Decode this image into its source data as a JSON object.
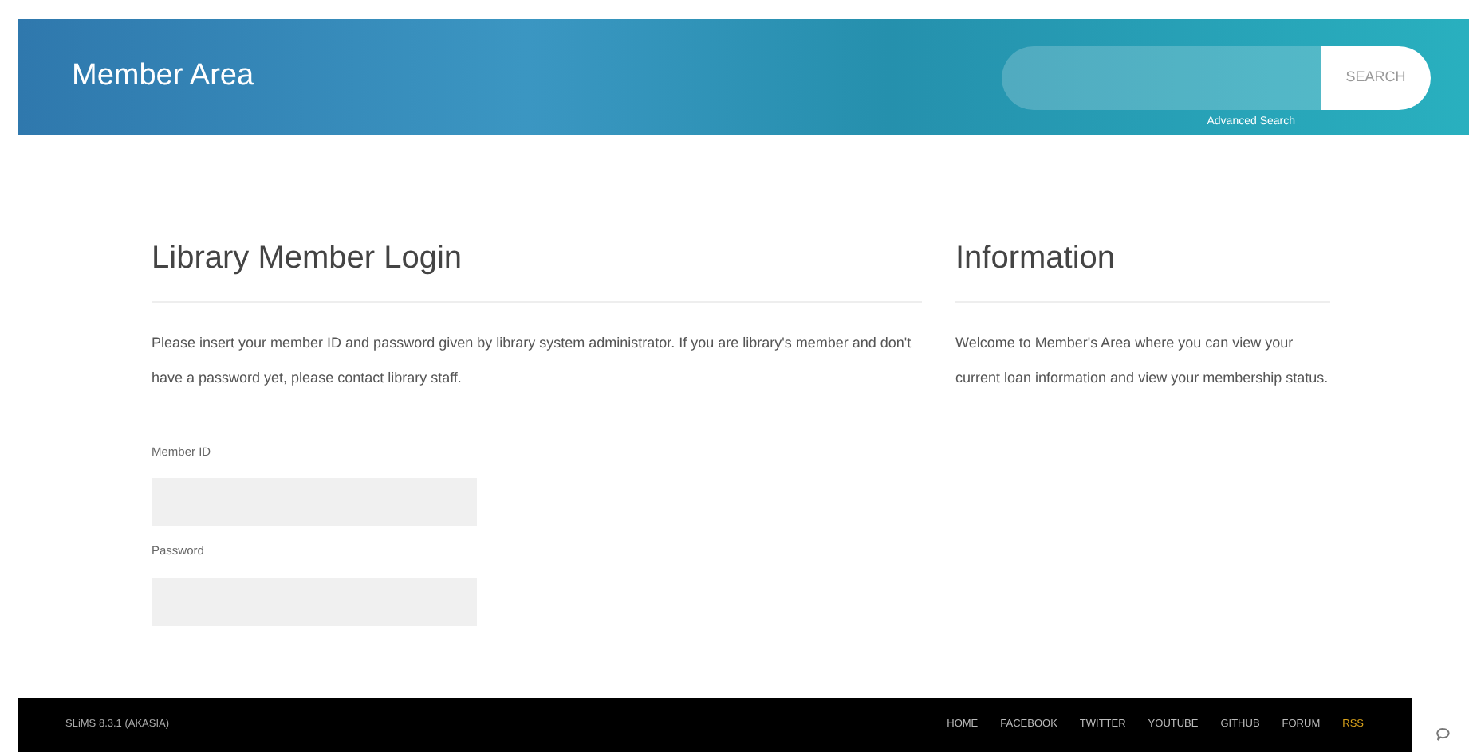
{
  "header": {
    "title": "Member Area",
    "search": {
      "button": "SEARCH"
    },
    "advanced_search": "Advanced Search"
  },
  "login": {
    "title": "Library Member Login",
    "intro": "Please insert your member ID and password given by library system administrator. If you are library's member and don't have a password yet, please contact library staff.",
    "fields": [
      {
        "label": "Member ID"
      },
      {
        "label": "Password"
      }
    ]
  },
  "info": {
    "title": "Information",
    "text": "Welcome to Member's Area where you can view your current loan information and view your membership status."
  },
  "footer": {
    "version": "SLiMS 8.3.1 (AKASIA)",
    "links": [
      {
        "label": "HOME",
        "color": "#bbbbbb"
      },
      {
        "label": "FACEBOOK",
        "color": "#bbbbbb"
      },
      {
        "label": "TWITTER",
        "color": "#bbbbbb"
      },
      {
        "label": "YOUTUBE",
        "color": "#bbbbbb"
      },
      {
        "label": "GITHUB",
        "color": "#bbbbbb"
      },
      {
        "label": "FORUM",
        "color": "#bbbbbb"
      },
      {
        "label": "RSS",
        "color": "#d9a21b"
      }
    ]
  }
}
